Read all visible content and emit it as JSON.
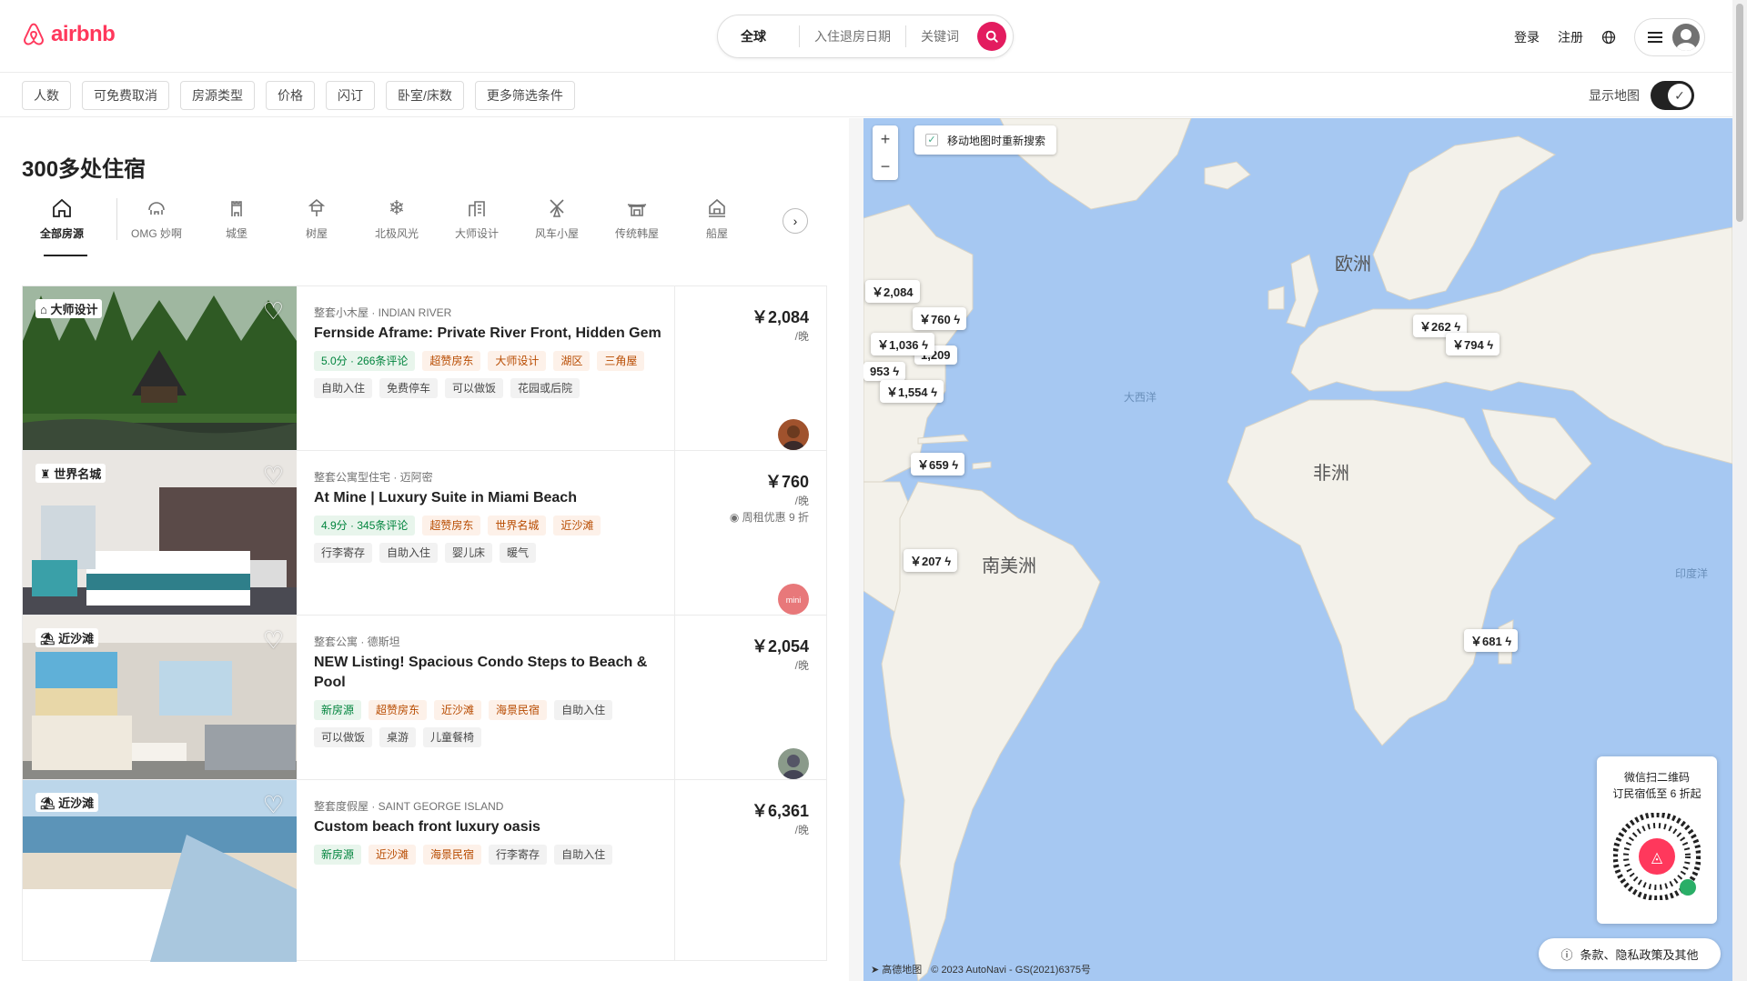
{
  "header": {
    "brand": "airbnb",
    "search": {
      "location": "全球",
      "dates": "入住退房日期",
      "keyword": "关键词"
    },
    "login": "登录",
    "signup": "注册"
  },
  "filters": {
    "chips": [
      "人数",
      "可免费取消",
      "房源类型",
      "价格",
      "闪订",
      "卧室/床数",
      "更多筛选条件"
    ],
    "show_map": "显示地图"
  },
  "listing": {
    "count_title": "300多处住宿",
    "categories": [
      {
        "label": "全部房源",
        "icon": "home-icon"
      },
      {
        "label": "OMG 妙啊",
        "icon": "omg-house-icon"
      },
      {
        "label": "城堡",
        "icon": "castle-icon"
      },
      {
        "label": "树屋",
        "icon": "treehouse-icon"
      },
      {
        "label": "北极风光",
        "icon": "snowflake-icon"
      },
      {
        "label": "大师设计",
        "icon": "design-icon"
      },
      {
        "label": "风车小屋",
        "icon": "windmill-icon"
      },
      {
        "label": "传统韩屋",
        "icon": "hanok-icon"
      },
      {
        "label": "船屋",
        "icon": "boathouse-icon"
      }
    ],
    "cards": [
      {
        "badge": "大师设计",
        "subtitle": "整套小木屋 · INDIAN RIVER",
        "title": "Fernside Aframe: Private River Front, Hidden Gem",
        "tags1": [
          "5.0分 · 266条评论",
          "超赞房东",
          "大师设计",
          "湖区",
          "三角屋"
        ],
        "tags2": [
          "自助入住",
          "免费停车",
          "可以做饭",
          "花园或后院"
        ],
        "price": "￥2,084",
        "per": "/晚",
        "discount": ""
      },
      {
        "badge": "世界名城",
        "subtitle": "整套公寓型住宅 · 迈阿密",
        "title": "At Mine | Luxury Suite in Miami Beach",
        "tags1": [
          "4.9分 · 345条评论",
          "超赞房东",
          "世界名城",
          "近沙滩"
        ],
        "tags2": [
          "行李寄存",
          "自助入住",
          "婴儿床",
          "暖气"
        ],
        "price": "￥760",
        "per": "/晚",
        "discount": "周租优惠 9 折"
      },
      {
        "badge": "近沙滩",
        "subtitle": "整套公寓 · 德斯坦",
        "title": "NEW Listing! Spacious Condo Steps to Beach & Pool",
        "tags1": [
          "新房源",
          "超赞房东",
          "近沙滩",
          "海景民宿",
          "自助入住"
        ],
        "tags2": [
          "可以做饭",
          "桌游",
          "儿童餐椅"
        ],
        "price": "￥2,054",
        "per": "/晚",
        "discount": ""
      },
      {
        "badge": "近沙滩",
        "subtitle": "整套度假屋 · SAINT GEORGE ISLAND",
        "title": "Custom beach front luxury oasis",
        "tags1": [
          "新房源",
          "近沙滩",
          "海景民宿",
          "行李寄存",
          "自助入住"
        ],
        "tags2": [],
        "price": "￥6,361",
        "per": "/晚",
        "discount": ""
      }
    ]
  },
  "map": {
    "research_label": "移动地图时重新搜索",
    "zoom_in": "+",
    "zoom_out": "−",
    "regions": {
      "europe": "欧洲",
      "africa": "非洲",
      "south_america": "南美洲",
      "atlantic": "大西洋",
      "indian": "印度洋"
    },
    "pins": [
      "￥2,084",
      "￥760 ϟ",
      "￥1,036 ϟ",
      "1,209",
      "953 ϟ",
      "￥1,554 ϟ",
      "￥659 ϟ",
      "￥207 ϟ",
      "￥262 ϟ",
      "￥794 ϟ",
      "￥681 ϟ"
    ],
    "qr": {
      "line1": "微信扫二维码",
      "line2": "订民宿低至 6 折起"
    },
    "legal": "条款、隐私政策及其他",
    "attribution": {
      "provider": "高德地图",
      "copyright": "© 2023 AutoNavi - GS(2021)6375号"
    }
  },
  "colors": {
    "brand": "#ff385c",
    "search_button": "#e31c5f",
    "sea": "#a6c8f2",
    "land": "#f3f1ea"
  }
}
